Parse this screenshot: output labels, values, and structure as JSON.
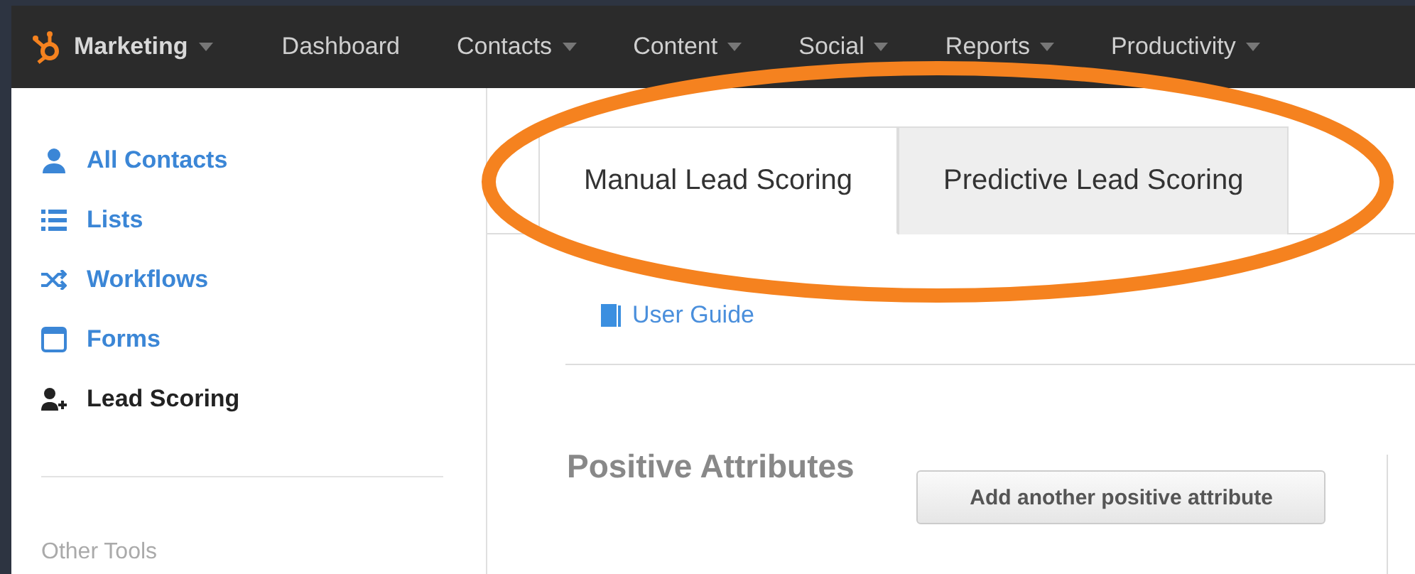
{
  "nav": {
    "brand": "Marketing",
    "items": [
      {
        "label": "Dashboard",
        "dropdown": false
      },
      {
        "label": "Contacts",
        "dropdown": true
      },
      {
        "label": "Content",
        "dropdown": true
      },
      {
        "label": "Social",
        "dropdown": true
      },
      {
        "label": "Reports",
        "dropdown": true
      },
      {
        "label": "Productivity",
        "dropdown": true
      }
    ]
  },
  "sidebar": {
    "items": [
      {
        "label": "All Contacts",
        "kind": "person",
        "selected": false
      },
      {
        "label": "Lists",
        "kind": "list",
        "selected": false
      },
      {
        "label": "Workflows",
        "kind": "shuffle",
        "selected": false
      },
      {
        "label": "Forms",
        "kind": "form",
        "selected": false
      },
      {
        "label": "Lead Scoring",
        "kind": "personadd",
        "selected": true
      }
    ],
    "section_title": "Other Tools"
  },
  "tabs": [
    {
      "label": "Manual Lead Scoring",
      "selected": true
    },
    {
      "label": "Predictive Lead Scoring",
      "selected": false
    }
  ],
  "user_guide": "User Guide",
  "section": {
    "title": "Positive Attributes",
    "button": "Add another positive attribute"
  },
  "annotation": {
    "kind": "ellipse",
    "color": "#f5821f"
  }
}
